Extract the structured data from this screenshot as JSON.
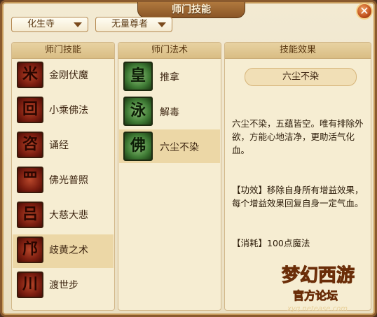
{
  "window": {
    "title": "师门技能",
    "close_label": "✕"
  },
  "filters": {
    "sect": "化生寺",
    "rank": "无量尊者"
  },
  "skills_panel": {
    "header": "师门技能",
    "items": [
      {
        "label": "金刚伏魔",
        "glyph": "米"
      },
      {
        "label": "小乘佛法",
        "glyph": "回"
      },
      {
        "label": "诵经",
        "glyph": "咨"
      },
      {
        "label": "佛光普照",
        "glyph": "罒"
      },
      {
        "label": "大慈大悲",
        "glyph": "吕"
      },
      {
        "label": "歧黄之术",
        "glyph": "邝"
      },
      {
        "label": "渡世步",
        "glyph": "川"
      }
    ],
    "selected": "歧黄之术"
  },
  "methods_panel": {
    "header": "师门法术",
    "items": [
      {
        "label": "推拿",
        "glyph": "皇"
      },
      {
        "label": "解毒",
        "glyph": "泳"
      },
      {
        "label": "六尘不染",
        "glyph": "佛"
      }
    ],
    "selected": "六尘不染"
  },
  "effect_panel": {
    "header": "技能效果",
    "title": "六尘不染",
    "description": "六尘不染，五蕴皆空。唯有排除外欲，方能心地洁净，更助活气化血。",
    "effect": "【功效】移除自身所有增益效果，每个增益效果回复自身一定气血。",
    "cost": "【消耗】100点魔法"
  },
  "logo": {
    "text": "梦幻西游",
    "sub": "官方论坛",
    "url": "xyq.netease.com"
  },
  "colors": {
    "frame": "#8a5a2e",
    "panel_bg": "#f6edd2",
    "selected_row": "#ecd7a6",
    "close_button": "#c0501c"
  },
  "icons": {
    "close": "close-icon",
    "dropdown": "chevron-down-icon"
  }
}
